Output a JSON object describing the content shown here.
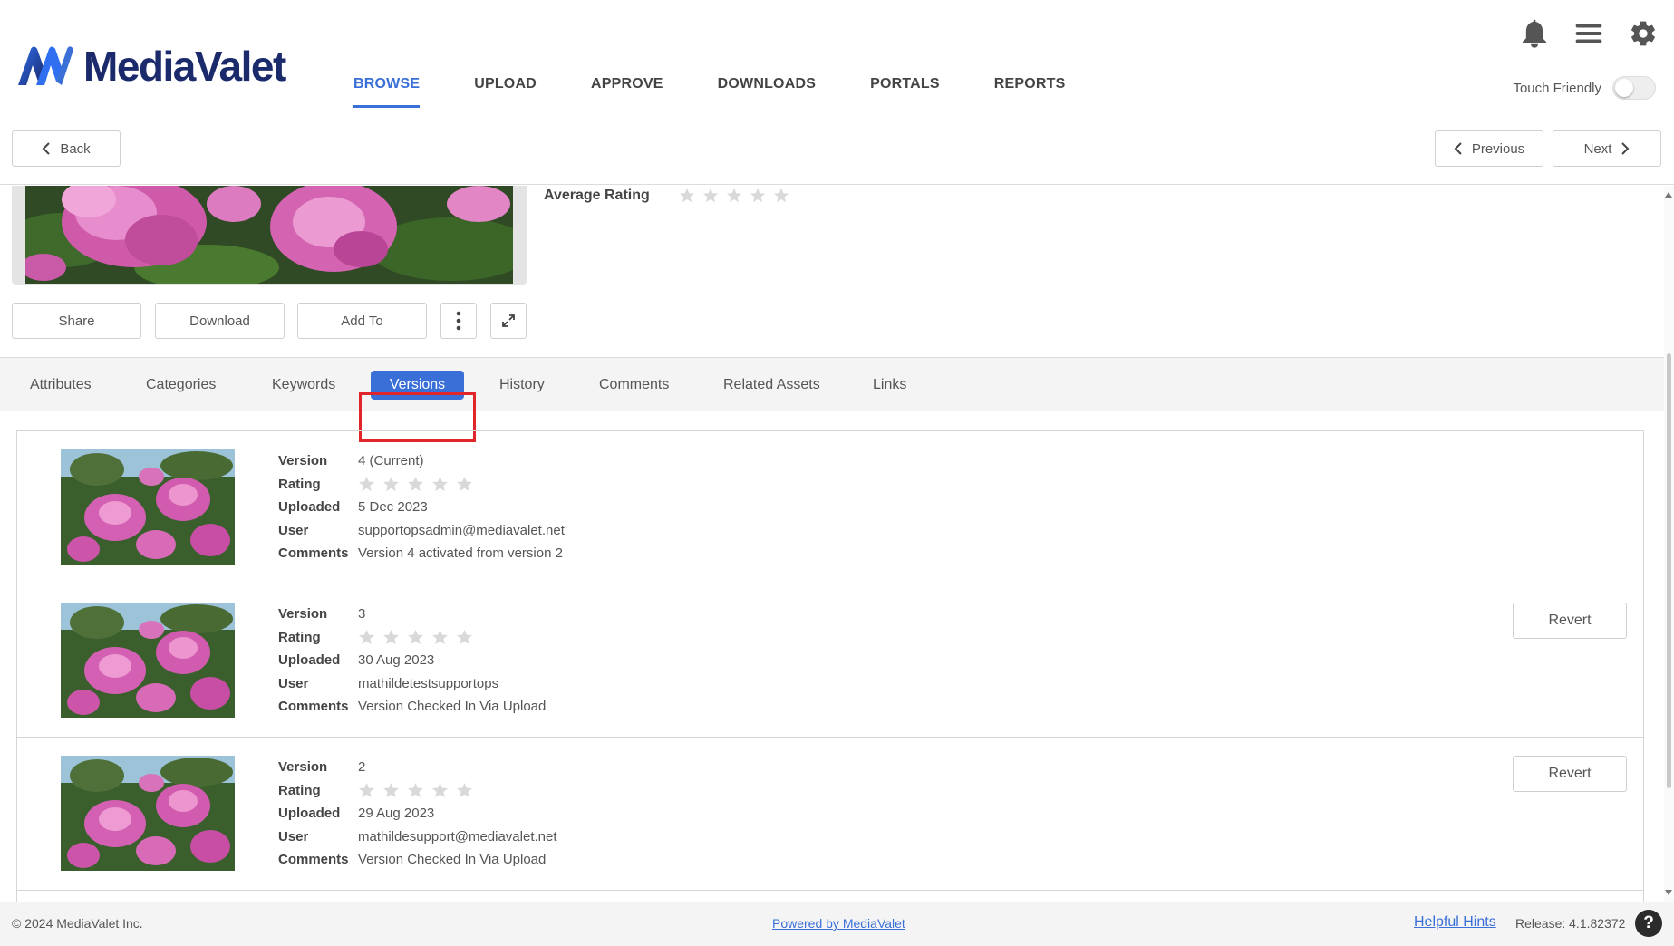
{
  "header": {
    "logo_text": "MediaValet",
    "nav": [
      {
        "label": "BROWSE",
        "active": true
      },
      {
        "label": "UPLOAD"
      },
      {
        "label": "APPROVE"
      },
      {
        "label": "DOWNLOADS"
      },
      {
        "label": "PORTALS"
      },
      {
        "label": "REPORTS"
      }
    ],
    "icons": [
      "bell-icon",
      "menu-icon",
      "gear-icon"
    ],
    "touch_friendly_label": "Touch Friendly",
    "touch_friendly_on": false
  },
  "toolbar": {
    "back_label": "Back",
    "previous_label": "Previous",
    "next_label": "Next"
  },
  "asset": {
    "average_rating_label": "Average Rating",
    "average_rating": 0,
    "actions": {
      "share": "Share",
      "download": "Download",
      "add_to": "Add To"
    }
  },
  "tabs": [
    {
      "label": "Attributes"
    },
    {
      "label": "Categories"
    },
    {
      "label": "Keywords"
    },
    {
      "label": "Versions",
      "active": true
    },
    {
      "label": "History"
    },
    {
      "label": "Comments"
    },
    {
      "label": "Related Assets"
    },
    {
      "label": "Links"
    }
  ],
  "versions": {
    "labels": {
      "version": "Version",
      "rating": "Rating",
      "uploaded": "Uploaded",
      "user": "User",
      "comments": "Comments"
    },
    "revert_label": "Revert",
    "rows": [
      {
        "version": "4 (Current)",
        "rating": 0,
        "uploaded": "5 Dec 2023",
        "user": "supportopsadmin@mediavalet.net",
        "comments": "Version 4 activated from version 2",
        "can_revert": false
      },
      {
        "version": "3",
        "rating": 0,
        "uploaded": "30 Aug 2023",
        "user": "mathildetestsupportops",
        "comments": "Version Checked In Via Upload",
        "can_revert": true
      },
      {
        "version": "2",
        "rating": 0,
        "uploaded": "29 Aug 2023",
        "user": "mathildesupport@mediavalet.net",
        "comments": "Version Checked In Via Upload",
        "can_revert": true
      }
    ]
  },
  "footer": {
    "copyright": "© 2024 MediaValet Inc.",
    "powered_by": "Powered by MediaValet",
    "helpful_hints": "Helpful Hints",
    "release": "Release: 4.1.82372",
    "help_label": "?"
  },
  "colors": {
    "accent": "#3a6fd8",
    "brand_dark": "#1b2a6b",
    "highlight": "#e0262b"
  }
}
